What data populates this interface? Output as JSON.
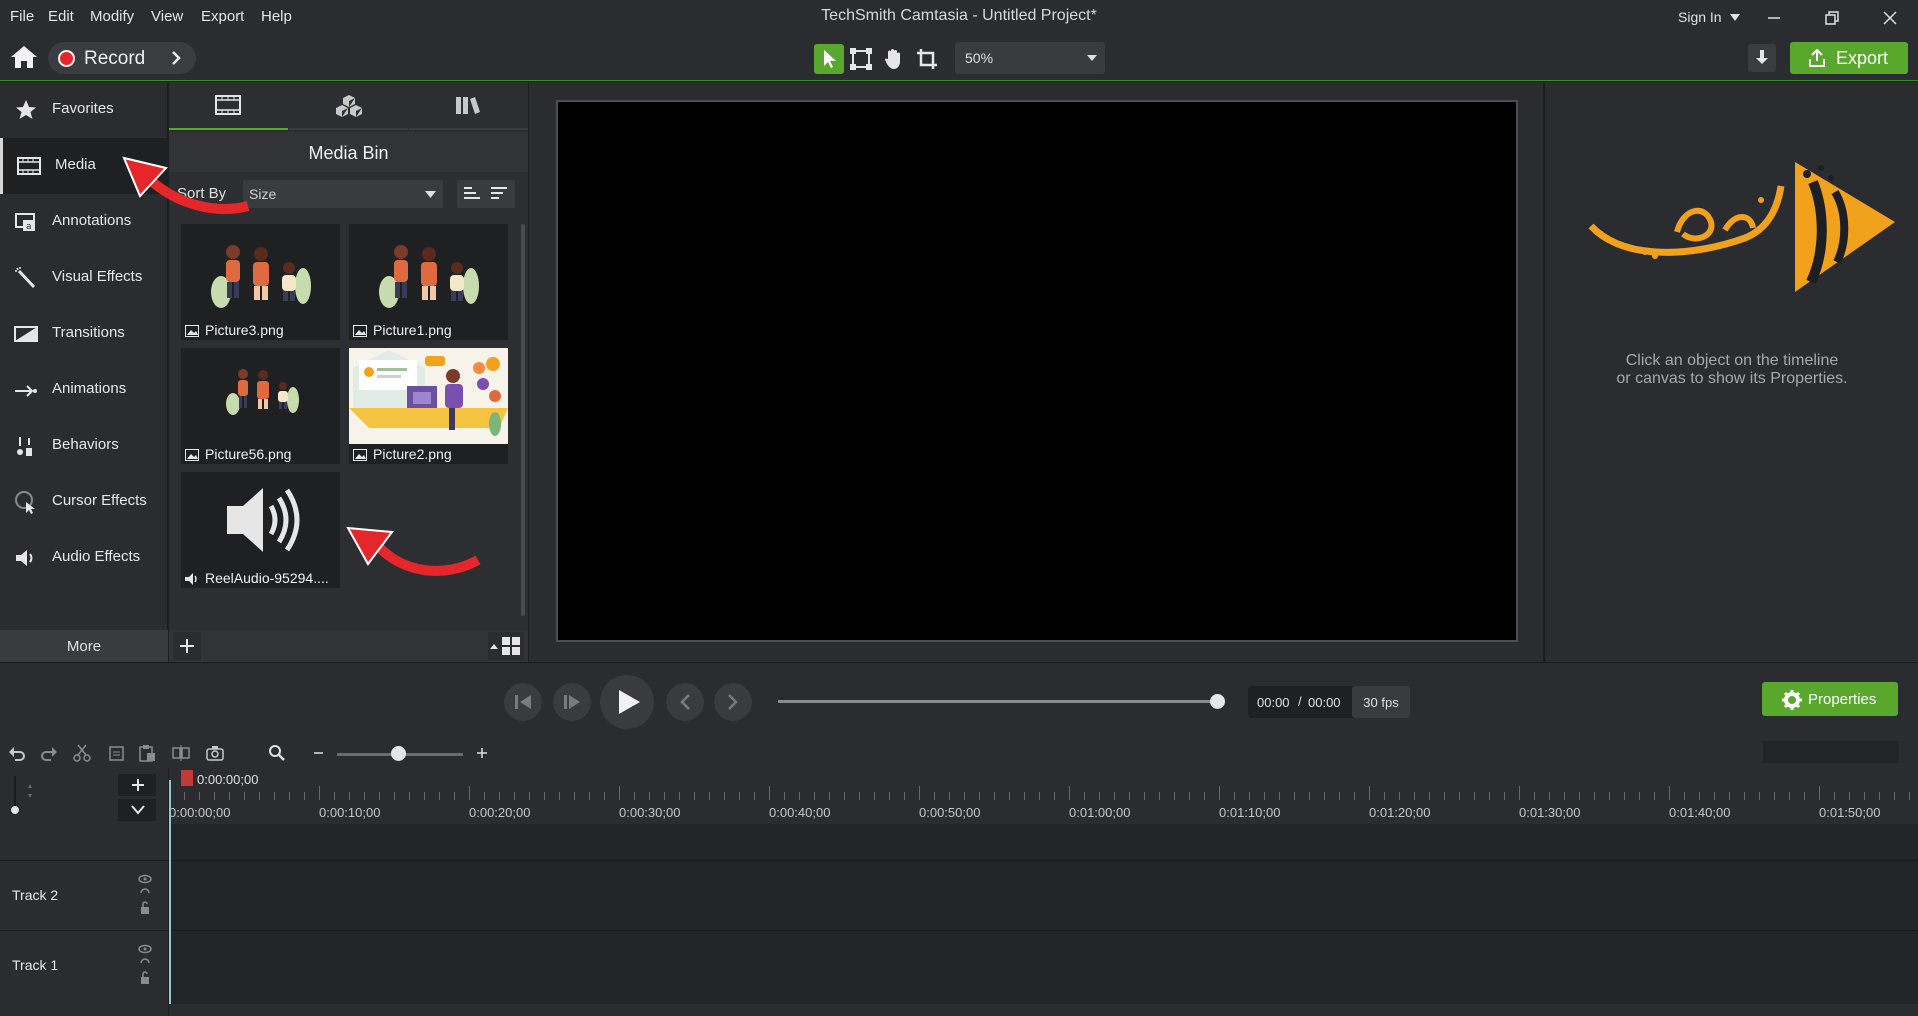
{
  "menu": [
    "File",
    "Edit",
    "Modify",
    "View",
    "Export",
    "Help"
  ],
  "app_title": "TechSmith Camtasia - Untitled Project*",
  "sign_in": "Sign In",
  "toolbar": {
    "record_label": "Record",
    "zoom_value": "50%",
    "export_label": "Export"
  },
  "nav": [
    {
      "label": "Favorites",
      "icon": "star-icon"
    },
    {
      "label": "Media",
      "icon": "film-icon"
    },
    {
      "label": "Annotations",
      "icon": "annotation-icon"
    },
    {
      "label": "Visual Effects",
      "icon": "wand-icon"
    },
    {
      "label": "Transitions",
      "icon": "transition-icon"
    },
    {
      "label": "Animations",
      "icon": "arrow-icon"
    },
    {
      "label": "Behaviors",
      "icon": "behaviors-icon"
    },
    {
      "label": "Cursor Effects",
      "icon": "cursor-icon"
    },
    {
      "label": "Audio Effects",
      "icon": "speaker-icon"
    }
  ],
  "more_label": "More",
  "media_bin": {
    "title": "Media Bin",
    "sort_by_label": "Sort By",
    "sort_value": "Size",
    "items": [
      {
        "name": "Picture3.png",
        "type": "image"
      },
      {
        "name": "Picture1.png",
        "type": "image"
      },
      {
        "name": "Picture56.png",
        "type": "image"
      },
      {
        "name": "Picture2.png",
        "type": "image"
      },
      {
        "name": "ReelAudio-95294....",
        "type": "audio"
      }
    ]
  },
  "properties_panel": {
    "hint_line1": "Click an object on the timeline",
    "hint_line2": "or canvas to show its Properties."
  },
  "playback": {
    "time_current": "00:00",
    "time_separator": "/",
    "time_total": "00:00",
    "fps": "30 fps",
    "properties_label": "Properties"
  },
  "timeline": {
    "playhead_time": "0:00:00;00",
    "ruler_labels": [
      "0:00:00;00",
      "0:00:10;00",
      "0:00:20;00",
      "0:00:30;00",
      "0:00:40;00",
      "0:00:50;00",
      "0:01:00;00",
      "0:01:10;00",
      "0:01:20;00",
      "0:01:30;00",
      "0:01:40;00",
      "0:01:50;00"
    ],
    "tracks": [
      "Track 2",
      "Track 1"
    ]
  },
  "colors": {
    "accent_green": "#5aa72d",
    "record_red": "#e5262b",
    "logo_orange": "#f2a11d"
  }
}
